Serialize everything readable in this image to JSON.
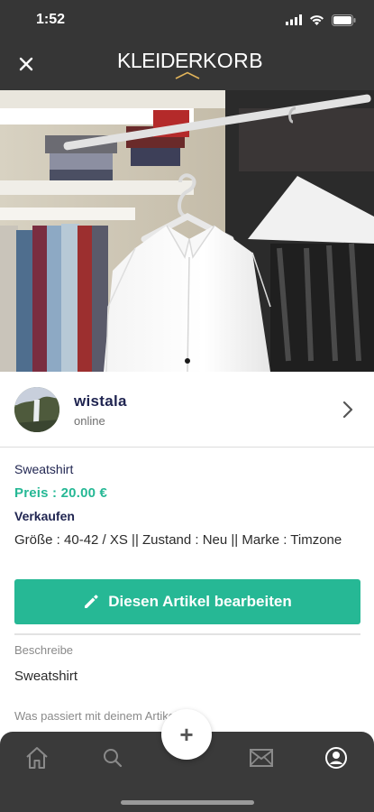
{
  "status_bar": {
    "time": "1:52"
  },
  "header": {
    "logo_light": "KLEIDER",
    "logo_bold": "KORB"
  },
  "seller": {
    "name": "wistala",
    "status": "online"
  },
  "article": {
    "title": "Sweatshirt",
    "price": "Preis : 20.00 €",
    "mode": "Verkaufen",
    "attributes": "Größe : 40-42 / XS || Zustand : Neu || Marke : Timzone"
  },
  "edit_button": {
    "label": "Diesen Artikel bearbeiten"
  },
  "description": {
    "label": "Beschreibe",
    "value": "Sweatshirt"
  },
  "what_happens": {
    "label": "Was passiert mit deinem Artikel"
  },
  "tabbar": {
    "fab_label": "+",
    "tabs": [
      "home-icon",
      "search-icon",
      "mail-icon",
      "profile-icon"
    ]
  },
  "colors": {
    "accent_green": "#26b895",
    "navy": "#1f2450",
    "topbar": "#363636",
    "tabbar": "#3a3a3a"
  }
}
